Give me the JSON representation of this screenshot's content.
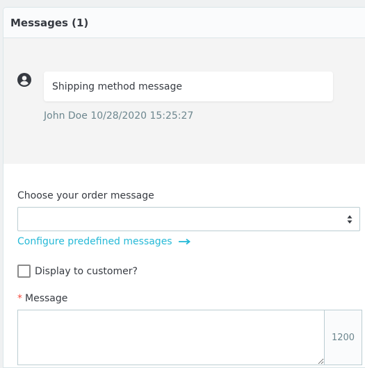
{
  "panel": {
    "title": "Messages (1)"
  },
  "conversation": {
    "message": "Shipping method message",
    "author": "John Doe",
    "timestamp": "10/28/2020 15:25:27",
    "avatar_icon": "user-circle-icon"
  },
  "form": {
    "choose_label": "Choose your order message",
    "select_value": "",
    "configure_link": "Configure predefined messages",
    "display_checkbox_label": "Display to customer?",
    "display_checked": false,
    "message_required_mark": "*",
    "message_label": "Message",
    "message_value": "",
    "char_counter": "1200"
  },
  "colors": {
    "link": "#25b9d7",
    "required": "#f54c3e",
    "muted": "#6c868e"
  }
}
